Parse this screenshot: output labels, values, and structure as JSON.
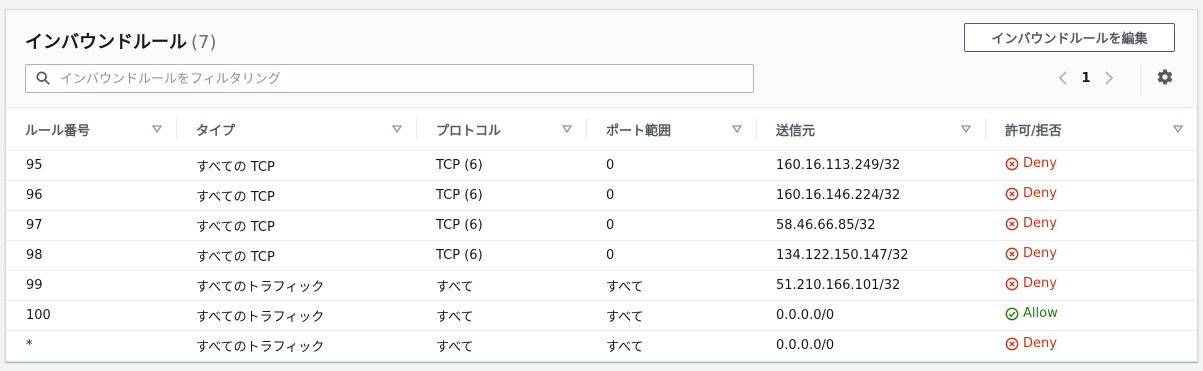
{
  "header": {
    "title": "インバウンドルール",
    "count": "(7)",
    "edit_button": "インバウンドルールを編集"
  },
  "search": {
    "placeholder": "インバウンドルールをフィルタリング",
    "value": ""
  },
  "pagination": {
    "current_page": "1"
  },
  "table": {
    "columns": [
      "ルール番号",
      "タイプ",
      "プロトコル",
      "ポート範囲",
      "送信元",
      "許可/拒否"
    ],
    "rows": [
      {
        "rule": "95",
        "type": "すべての TCP",
        "protocol": "TCP (6)",
        "port": "0",
        "source": "160.16.113.249/32",
        "action": "Deny"
      },
      {
        "rule": "96",
        "type": "すべての TCP",
        "protocol": "TCP (6)",
        "port": "0",
        "source": "160.16.146.224/32",
        "action": "Deny"
      },
      {
        "rule": "97",
        "type": "すべての TCP",
        "protocol": "TCP (6)",
        "port": "0",
        "source": "58.46.66.85/32",
        "action": "Deny"
      },
      {
        "rule": "98",
        "type": "すべての TCP",
        "protocol": "TCP (6)",
        "port": "0",
        "source": "134.122.150.147/32",
        "action": "Deny"
      },
      {
        "rule": "99",
        "type": "すべてのトラフィック",
        "protocol": "すべて",
        "port": "すべて",
        "source": "51.210.166.101/32",
        "action": "Deny"
      },
      {
        "rule": "100",
        "type": "すべてのトラフィック",
        "protocol": "すべて",
        "port": "すべて",
        "source": "0.0.0.0/0",
        "action": "Allow"
      },
      {
        "rule": "*",
        "type": "すべてのトラフィック",
        "protocol": "すべて",
        "port": "すべて",
        "source": "0.0.0.0/0",
        "action": "Deny"
      }
    ]
  },
  "colors": {
    "deny": "#d13212",
    "allow": "#1d8102",
    "border": "#eaeded",
    "text": "#16191f"
  },
  "icons": {
    "search": "search-icon",
    "prev": "chevron-left-icon",
    "next": "chevron-right-icon",
    "settings": "gear-icon",
    "sort": "caret-down-icon",
    "deny": "x-circle-icon",
    "allow": "check-circle-icon"
  }
}
